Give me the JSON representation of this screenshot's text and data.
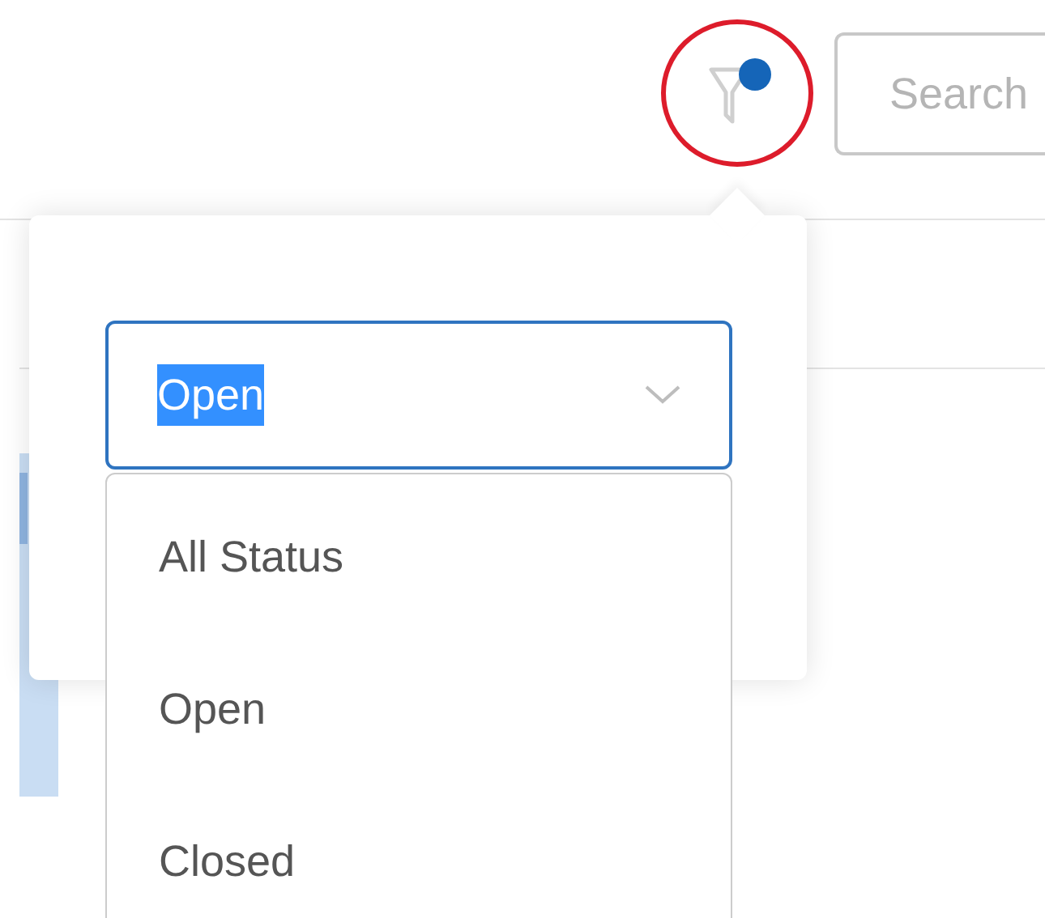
{
  "toolbar": {
    "filter_button": {
      "active": true
    },
    "search": {
      "placeholder": "Search"
    }
  },
  "annotations": [
    {
      "kind": "circle",
      "color": "#dd1c2b"
    }
  ],
  "filter_popover": {
    "status_select": {
      "value": "Open",
      "text_selected": true,
      "open": true
    },
    "options": [
      {
        "label": "All Status",
        "selected": false
      },
      {
        "label": "Open",
        "selected": false
      },
      {
        "label": "Closed",
        "selected": false
      }
    ]
  }
}
